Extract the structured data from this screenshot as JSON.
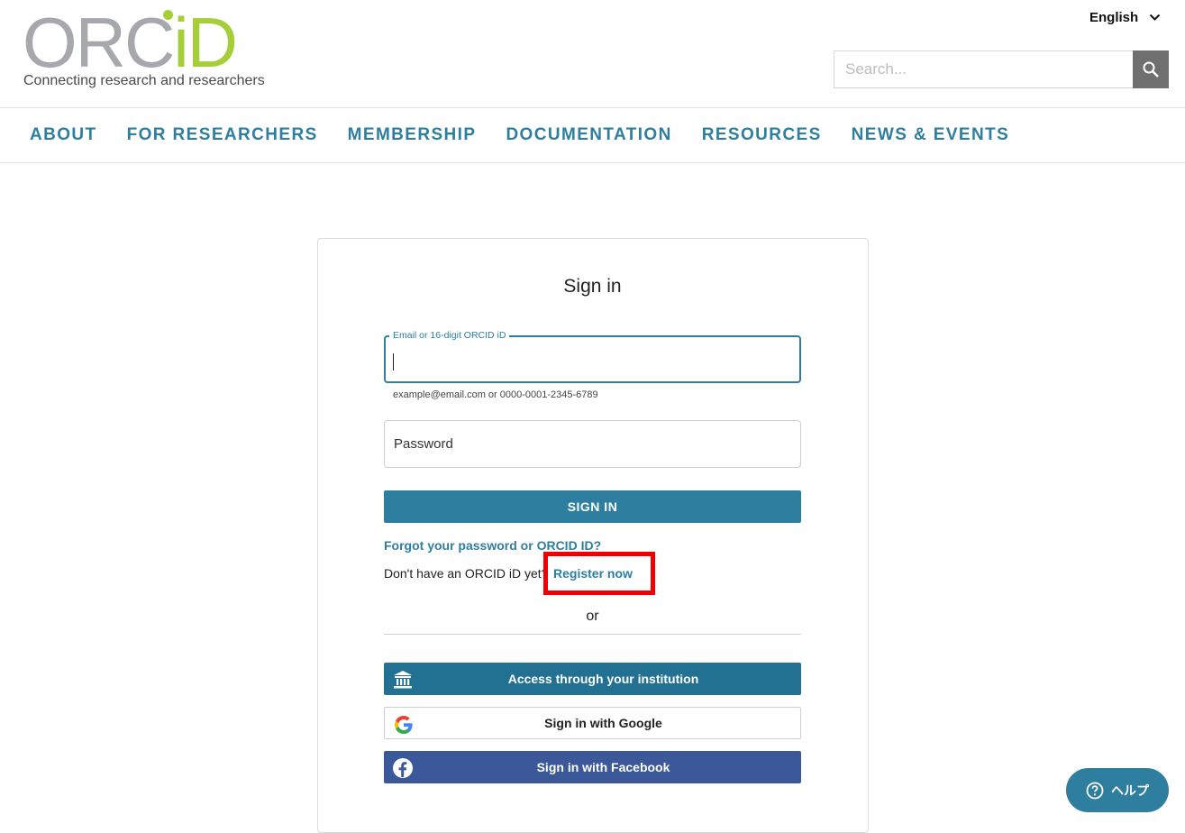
{
  "header": {
    "logo": {
      "word_grey": "ORC",
      "word_green": "iD",
      "tagline": "Connecting research and researchers"
    },
    "language": "English",
    "search": {
      "placeholder": "Search..."
    }
  },
  "nav": [
    {
      "label": "ABOUT"
    },
    {
      "label": "FOR RESEARCHERS"
    },
    {
      "label": "MEMBERSHIP"
    },
    {
      "label": "DOCUMENTATION"
    },
    {
      "label": "RESOURCES"
    },
    {
      "label": "NEWS & EVENTS"
    }
  ],
  "signin": {
    "title": "Sign in",
    "email_label": "Email or 16-digit ORCID iD",
    "email_value": "",
    "email_hint": "example@email.com or 0000-0001-2345-6789",
    "password_placeholder": "Password",
    "submit_label": "SIGN IN",
    "forgot_label": "Forgot your password or ORCID ID?",
    "no_account_text": "Don't have an ORCID iD yet?",
    "register_label": "Register now",
    "or_text": "or",
    "institution_label": "Access through your institution",
    "google_label": "Sign in with Google",
    "facebook_label": "Sign in with Facebook"
  },
  "help": {
    "label": "ヘルプ"
  },
  "colors": {
    "brand_teal": "#2e7f9f",
    "logo_green": "#a6ce39",
    "logo_grey": "#a6a8ab",
    "facebook_blue": "#3b5998",
    "highlight_red": "#ee0000"
  }
}
